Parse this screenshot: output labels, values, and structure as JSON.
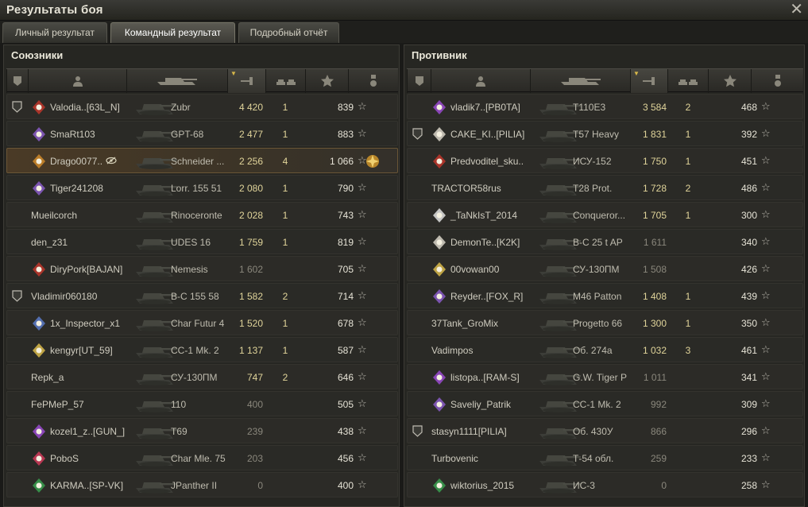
{
  "window": {
    "title": "Результаты боя",
    "close_glyph": "✕"
  },
  "tabs": [
    {
      "label": "Личный результат",
      "active": false
    },
    {
      "label": "Командный результат",
      "active": true
    },
    {
      "label": "Подробный отчёт",
      "active": false
    }
  ],
  "allies": {
    "title": "Союзники",
    "rows": [
      {
        "squad": true,
        "badge": "clan-red",
        "name": "Valodia..[63L_N]",
        "vehicle": "Zubr",
        "damage": "4 420",
        "kills": "1",
        "xp": "839",
        "me": false,
        "medal": false
      },
      {
        "squad": false,
        "badge": "clan-purple",
        "name": "SmaRt103",
        "vehicle": "GPT-68",
        "damage": "2 477",
        "kills": "1",
        "xp": "883",
        "me": false,
        "medal": false
      },
      {
        "squad": false,
        "badge": "clan-orange",
        "name": "Drago0077..",
        "vehicle": "Schneider ...",
        "damage": "2 256",
        "kills": "4",
        "xp": "1 066",
        "me": true,
        "medal": true,
        "spotted": true
      },
      {
        "squad": false,
        "badge": "clan-purple",
        "name": "Tiger241208",
        "vehicle": "Lorr. 155 51",
        "damage": "2 080",
        "kills": "1",
        "xp": "790",
        "me": false,
        "medal": false
      },
      {
        "squad": false,
        "badge": "",
        "name": "Mueilcorch",
        "vehicle": "Rinoceronte",
        "damage": "2 028",
        "kills": "1",
        "xp": "743",
        "me": false,
        "medal": false
      },
      {
        "squad": false,
        "badge": "",
        "name": "den_z31",
        "vehicle": "UDES 16",
        "damage": "1 759",
        "kills": "1",
        "xp": "819",
        "me": false,
        "medal": false
      },
      {
        "squad": false,
        "badge": "clan-red",
        "name": "DiryPork[BAJAN]",
        "vehicle": "Nemesis",
        "damage": "1 602",
        "kills": "",
        "xp": "705",
        "me": false,
        "medal": false
      },
      {
        "squad": true,
        "badge": "",
        "name": "Vladimir060180",
        "vehicle": "В-С 155 58",
        "damage": "1 582",
        "kills": "2",
        "xp": "714",
        "me": false,
        "medal": false
      },
      {
        "squad": false,
        "badge": "clan-blue",
        "name": "1x_Inspector_x1",
        "vehicle": "Char Futur 4",
        "damage": "1 520",
        "kills": "1",
        "xp": "678",
        "me": false,
        "medal": false
      },
      {
        "squad": false,
        "badge": "clan-gold",
        "name": "kengyr[UT_59]",
        "vehicle": "СС-1 Mk. 2",
        "damage": "1 137",
        "kills": "1",
        "xp": "587",
        "me": false,
        "medal": false
      },
      {
        "squad": false,
        "badge": "",
        "name": "Repk_a",
        "vehicle": "СУ-130ПМ",
        "damage": "747",
        "kills": "2",
        "xp": "646",
        "me": false,
        "medal": false
      },
      {
        "squad": false,
        "badge": "",
        "name": "FePMeP_57",
        "vehicle": "110",
        "damage": "400",
        "kills": "",
        "xp": "505",
        "me": false,
        "medal": false
      },
      {
        "squad": false,
        "badge": "clan-violet",
        "name": "kozel1_z..[GUN_]",
        "vehicle": "T69",
        "damage": "239",
        "kills": "",
        "xp": "438",
        "me": false,
        "medal": false
      },
      {
        "squad": false,
        "badge": "clan-pink",
        "name": "PoboS",
        "vehicle": "Char Mle. 75",
        "damage": "203",
        "kills": "",
        "xp": "456",
        "me": false,
        "medal": false
      },
      {
        "squad": false,
        "badge": "clan-green",
        "name": "KARMA..[SP-VK]",
        "vehicle": "JPanther II",
        "damage": "0",
        "kills": "",
        "xp": "400",
        "me": false,
        "medal": false
      }
    ]
  },
  "enemies": {
    "title": "Противник",
    "rows": [
      {
        "squad": false,
        "badge": "clan-violet",
        "name": "vladik7..[PB0TA]",
        "vehicle": "T110E3",
        "damage": "3 584",
        "kills": "2",
        "xp": "468"
      },
      {
        "squad": true,
        "badge": "clan-white",
        "name": "CAKE_KI..[PILIA]",
        "vehicle": "T57 Heavy",
        "damage": "1 831",
        "kills": "1",
        "xp": "392"
      },
      {
        "squad": false,
        "badge": "clan-red",
        "name": "Predvoditel_sku..",
        "vehicle": "ИСУ-152",
        "damage": "1 750",
        "kills": "1",
        "xp": "451"
      },
      {
        "squad": false,
        "badge": "",
        "name": "TRACTOR58rus",
        "vehicle": "T28 Prot.",
        "damage": "1 728",
        "kills": "2",
        "xp": "486"
      },
      {
        "squad": false,
        "badge": "clan-skull",
        "name": "_TaNkIsT_2014",
        "vehicle": "Conqueror...",
        "damage": "1 705",
        "kills": "1",
        "xp": "300"
      },
      {
        "squad": false,
        "badge": "clan-white",
        "name": "DemonTe..[K2K]",
        "vehicle": "В-С 25 t AP",
        "damage": "1 611",
        "kills": "",
        "xp": "340"
      },
      {
        "squad": false,
        "badge": "clan-gold",
        "name": "00vowan00",
        "vehicle": "СУ-130ПМ",
        "damage": "1 508",
        "kills": "",
        "xp": "426"
      },
      {
        "squad": false,
        "badge": "clan-purple",
        "name": "Reyder..[FOX_R]",
        "vehicle": "M46 Patton",
        "damage": "1 408",
        "kills": "1",
        "xp": "439"
      },
      {
        "squad": false,
        "badge": "",
        "name": "37Tank_GroMix",
        "vehicle": "Progetto 66",
        "damage": "1 300",
        "kills": "1",
        "xp": "350"
      },
      {
        "squad": false,
        "badge": "",
        "name": "Vadimpos",
        "vehicle": "Об. 274а",
        "damage": "1 032",
        "kills": "3",
        "xp": "461"
      },
      {
        "squad": false,
        "badge": "clan-violet",
        "name": "listopa..[RAM-S]",
        "vehicle": "G.W. Tiger P",
        "damage": "1 011",
        "kills": "",
        "xp": "341"
      },
      {
        "squad": false,
        "badge": "clan-purple",
        "name": "Saveliy_Patrik",
        "vehicle": "СС-1 Mk. 2",
        "damage": "992",
        "kills": "",
        "xp": "309"
      },
      {
        "squad": true,
        "badge": "",
        "name": "stasyn1111[PILIA]",
        "vehicle": "Об. 430У",
        "damage": "866",
        "kills": "",
        "xp": "296"
      },
      {
        "squad": false,
        "badge": "",
        "name": "Turbovenic",
        "vehicle": "Т-54 обл.",
        "damage": "259",
        "kills": "",
        "xp": "233"
      },
      {
        "squad": false,
        "badge": "clan-green",
        "name": "wiktorius_2015",
        "vehicle": "ИС-3",
        "damage": "0",
        "kills": "",
        "xp": "258"
      }
    ]
  },
  "columns": [
    "squad-col",
    "player-col",
    "vehicle-col",
    "damage-col",
    "kills-col",
    "xp-col",
    "medal-col"
  ],
  "icons": {
    "star": "☆",
    "sort": "▼"
  },
  "colors": {
    "accent": "#d8b84a",
    "player_row": "#4a3a26"
  }
}
